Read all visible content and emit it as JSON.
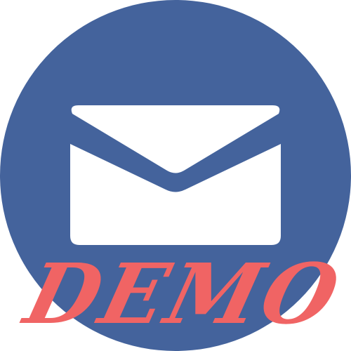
{
  "icon": {
    "name": "mail-icon",
    "circle_color": "#44639C",
    "envelope_color": "#FFFFFF"
  },
  "watermark": {
    "text": "DEMO",
    "color": "#F06464"
  }
}
